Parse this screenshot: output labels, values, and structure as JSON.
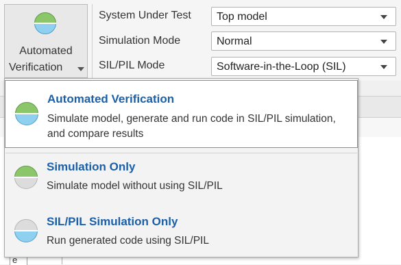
{
  "toolstrip": {
    "verify_button": {
      "line1": "Automated",
      "line2": "Verification"
    },
    "params": [
      {
        "label": "System Under Test",
        "value": "Top model"
      },
      {
        "label": "Simulation Mode",
        "value": "Normal"
      },
      {
        "label": "SIL/PIL Mode",
        "value": "Software-in-the-Loop (SIL)"
      }
    ]
  },
  "background": {
    "tab_text": "e"
  },
  "menu": {
    "items": [
      {
        "title": "Automated Verification",
        "description": "Simulate model, generate and run code in SIL/PIL simulation, and compare results",
        "icon": "green-blue-circle-icon",
        "selected": true
      },
      {
        "title": "Simulation Only",
        "description": "Simulate model without using SIL/PIL",
        "icon": "green-circle-icon",
        "selected": false
      },
      {
        "title": "SIL/PIL Simulation Only",
        "description": "Run generated code using SIL/PIL",
        "icon": "blue-circle-icon",
        "selected": false
      }
    ]
  },
  "colors": {
    "accent": "#1a5fa8",
    "selection_border": "#5b9bd5",
    "green": "#8cc66a",
    "blue": "#8fd0f0"
  }
}
